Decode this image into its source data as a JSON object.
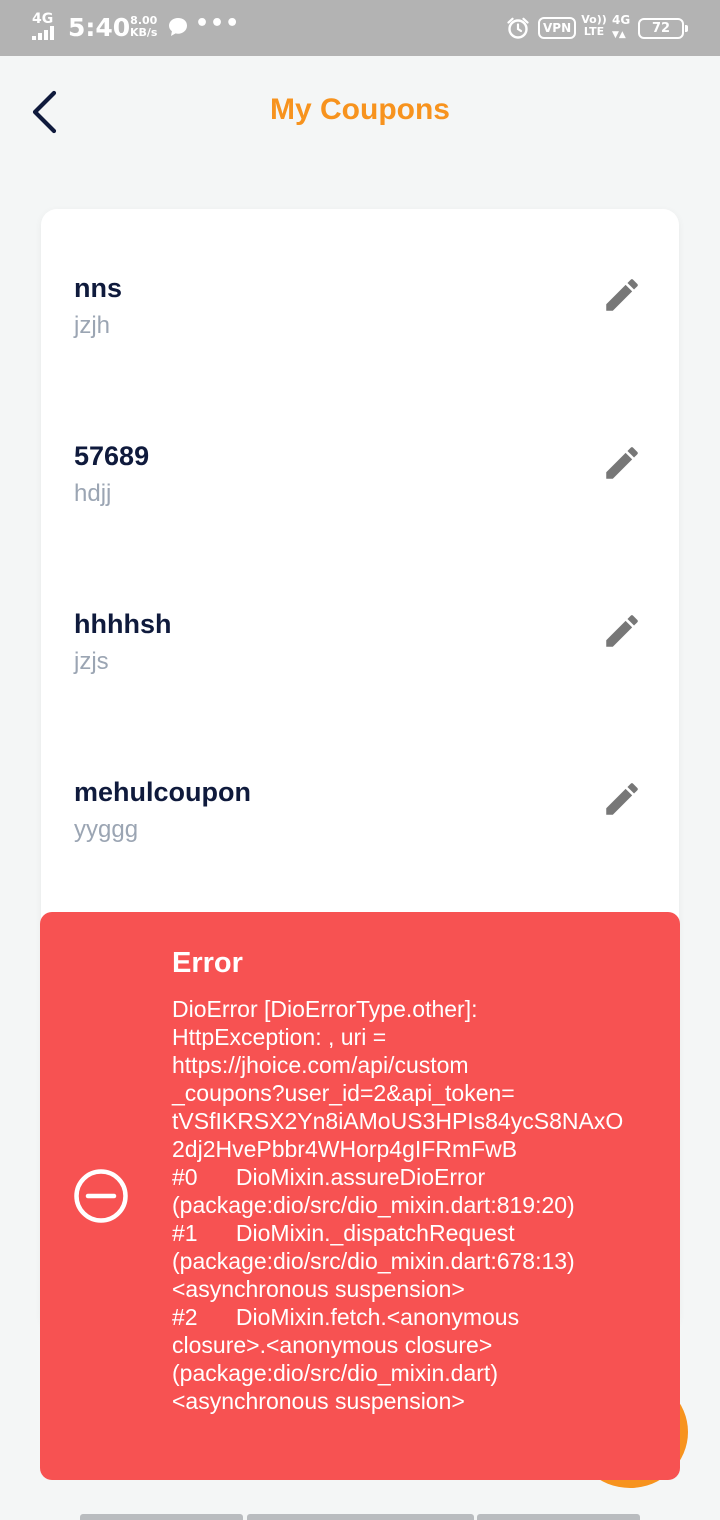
{
  "status_bar": {
    "network": "4G",
    "time": "5:40",
    "speed_value": "8.00",
    "speed_unit": "KB/s",
    "more_dots": "•••",
    "vpn": "VPN",
    "volte_top": "Vo))",
    "volte_bottom": "LTE",
    "network_right": "4G",
    "battery": "72"
  },
  "header": {
    "title": "My Coupons",
    "back_icon": "chevron-left-icon"
  },
  "coupons": [
    {
      "name": "nns",
      "description": "jzjh"
    },
    {
      "name": "57689",
      "description": "hdjj"
    },
    {
      "name": "hhhhsh",
      "description": "jzjs"
    },
    {
      "name": "mehulcoupon",
      "description": "yyggg"
    }
  ],
  "error_toast": {
    "title": "Error",
    "message": "DioError [DioErrorType.other]:\nHttpException: , uri =\nhttps://jhoice.com/api/custom\n_coupons?user_id=2&api_token=\ntVSfIKRSX2Yn8iAMoUS3HPIs84ycS8NAxO\n2dj2HvePbbr4WHorp4gIFRmFwB\n#0      DioMixin.assureDioError\n(package:dio/src/dio_mixin.dart:819:20)\n#1      DioMixin._dispatchRequest\n(package:dio/src/dio_mixin.dart:678:13)\n<asynchronous suspension>\n#2      DioMixin.fetch.<anonymous\nclosure>.<anonymous closure>\n(package:dio/src/dio_mixin.dart)\n<asynchronous suspension>",
    "icon": "minus-circle-icon"
  },
  "colors": {
    "accent": "#f7931e",
    "error": "#f75252",
    "title_text": "#0f1a3c",
    "muted_text": "#9ba5b3",
    "background": "#f4f6f6"
  }
}
